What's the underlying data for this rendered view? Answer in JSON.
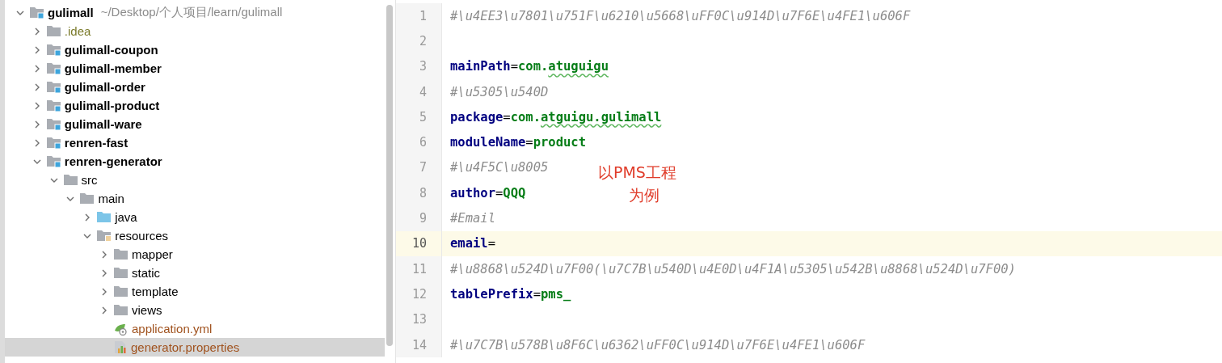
{
  "project_tree": {
    "items": [
      {
        "label": "gulimall",
        "kind": "module",
        "path": "~/Desktop/个人项目/learn/gulimall",
        "expanded": true,
        "selected": false,
        "children": [
          {
            "label": ".idea",
            "kind": "folder",
            "color": "#7a7a2a",
            "expanded": false,
            "selected": false
          },
          {
            "label": "gulimall-coupon",
            "kind": "module",
            "expanded": false,
            "selected": false
          },
          {
            "label": "gulimall-member",
            "kind": "module",
            "expanded": false,
            "selected": false
          },
          {
            "label": "gulimall-order",
            "kind": "module",
            "expanded": false,
            "selected": false
          },
          {
            "label": "gulimall-product",
            "kind": "module",
            "expanded": false,
            "selected": false
          },
          {
            "label": "gulimall-ware",
            "kind": "module",
            "expanded": false,
            "selected": false
          },
          {
            "label": "renren-fast",
            "kind": "module",
            "expanded": false,
            "selected": false
          },
          {
            "label": "renren-generator",
            "kind": "module",
            "expanded": true,
            "selected": false,
            "children": [
              {
                "label": "src",
                "kind": "folder",
                "expanded": true,
                "selected": false,
                "children": [
                  {
                    "label": "main",
                    "kind": "folder",
                    "expanded": true,
                    "selected": false,
                    "children": [
                      {
                        "label": "java",
                        "kind": "source-folder",
                        "expanded": false,
                        "selected": false
                      },
                      {
                        "label": "resources",
                        "kind": "resource-folder",
                        "expanded": true,
                        "selected": false,
                        "children": [
                          {
                            "label": "mapper",
                            "kind": "folder",
                            "expanded": false,
                            "selected": false
                          },
                          {
                            "label": "static",
                            "kind": "folder",
                            "expanded": false,
                            "selected": false
                          },
                          {
                            "label": "template",
                            "kind": "folder",
                            "expanded": false,
                            "selected": false
                          },
                          {
                            "label": "views",
                            "kind": "folder",
                            "expanded": false,
                            "selected": false
                          },
                          {
                            "label": "application.yml",
                            "kind": "yml-file",
                            "color": "#a0521e",
                            "selected": false
                          },
                          {
                            "label": "generator.properties",
                            "kind": "properties-file",
                            "color": "#a0521e",
                            "selected": true
                          }
                        ]
                      }
                    ]
                  }
                ]
              }
            ]
          }
        ]
      }
    ]
  },
  "editor": {
    "lines": [
      {
        "number": "1",
        "current": false,
        "tokens": [
          {
            "kind": "comment",
            "text": "#\\u4EE3\\u7801\\u751F\\u6210\\u5668\\uFF0C\\u914D\\u7F6E\\u4FE1\\u606F"
          }
        ]
      },
      {
        "number": "2",
        "current": false
      },
      {
        "number": "3",
        "current": false,
        "tokens": [
          {
            "kind": "key",
            "text": "mainPath"
          },
          {
            "kind": "eq",
            "text": "="
          },
          {
            "kind": "value",
            "text": "com."
          },
          {
            "kind": "value",
            "text": "atuguigu",
            "typo": true
          }
        ]
      },
      {
        "number": "4",
        "current": false,
        "tokens": [
          {
            "kind": "comment",
            "text": "#\\u5305\\u540D"
          }
        ]
      },
      {
        "number": "5",
        "current": false,
        "tokens": [
          {
            "kind": "key",
            "text": "package"
          },
          {
            "kind": "eq",
            "text": "="
          },
          {
            "kind": "value",
            "text": "com."
          },
          {
            "kind": "value",
            "text": "atguigu.gulimall",
            "typo": true
          }
        ]
      },
      {
        "number": "6",
        "current": false,
        "tokens": [
          {
            "kind": "key",
            "text": "moduleName"
          },
          {
            "kind": "eq",
            "text": "="
          },
          {
            "kind": "value",
            "text": "product"
          }
        ]
      },
      {
        "number": "7",
        "current": false,
        "tokens": [
          {
            "kind": "comment",
            "text": "#\\u4F5C\\u8005"
          }
        ]
      },
      {
        "number": "8",
        "current": false,
        "tokens": [
          {
            "kind": "key",
            "text": "author"
          },
          {
            "kind": "eq",
            "text": "="
          },
          {
            "kind": "value",
            "text": "QQQ"
          }
        ]
      },
      {
        "number": "9",
        "current": false,
        "tokens": [
          {
            "kind": "comment",
            "text": "#Email"
          }
        ]
      },
      {
        "number": "10",
        "current": true,
        "tokens": [
          {
            "kind": "key",
            "text": "email"
          },
          {
            "kind": "eq",
            "text": "="
          }
        ]
      },
      {
        "number": "11",
        "current": false,
        "tokens": [
          {
            "kind": "comment",
            "text": "#\\u8868\\u524D\\u7F00(\\u7C7B\\u540D\\u4E0D\\u4F1A\\u5305\\u542B\\u8868\\u524D\\u7F00)"
          }
        ]
      },
      {
        "number": "12",
        "current": false,
        "tokens": [
          {
            "kind": "key",
            "text": "tablePrefix"
          },
          {
            "kind": "eq",
            "text": "="
          },
          {
            "kind": "value",
            "text": "pms_"
          }
        ]
      },
      {
        "number": "13",
        "current": false
      },
      {
        "number": "14",
        "current": false,
        "tokens": [
          {
            "kind": "comment",
            "text": "#\\u7C7B\\u578B\\u8F6C\\u6362\\uFF0C\\u914D\\u7F6E\\u4FE1\\u606F"
          }
        ]
      }
    ],
    "annotation": [
      "以PMS工程",
      "为例"
    ]
  }
}
